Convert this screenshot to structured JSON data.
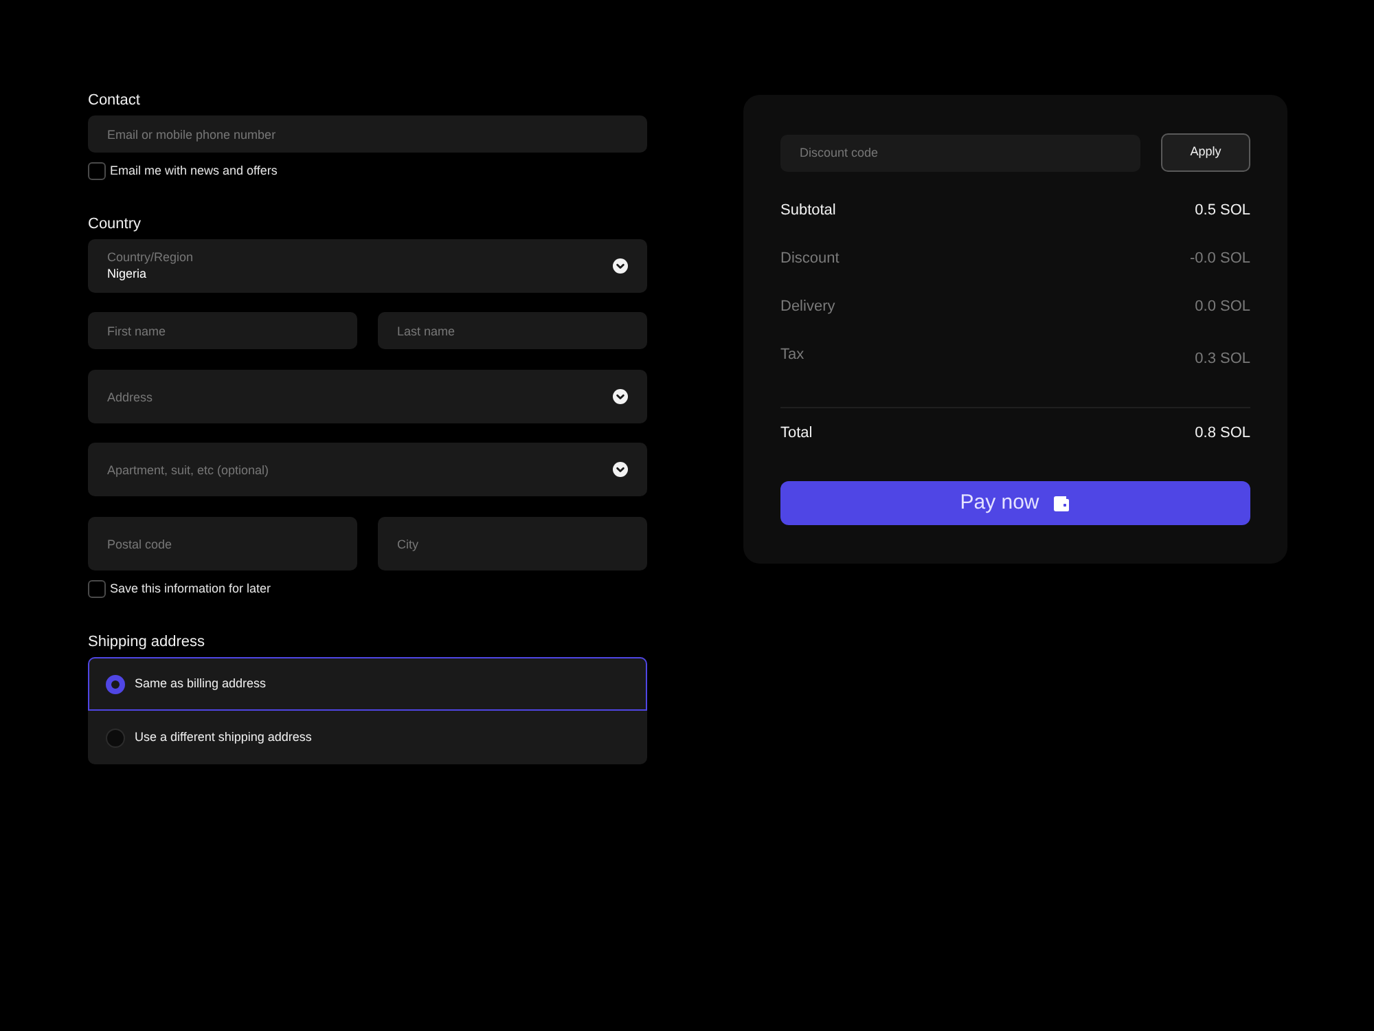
{
  "contact": {
    "heading": "Contact",
    "email": {
      "placeholder": "Email or mobile phone number"
    },
    "newsletter": {
      "label": "Email me with news and offers",
      "checked": false
    }
  },
  "country": {
    "heading": "Country",
    "select": {
      "label": "Country/Region",
      "value": "Nigeria"
    }
  },
  "name_fields": [
    {
      "placeholder": "First name"
    },
    {
      "placeholder": "Last name"
    }
  ],
  "address": {
    "placeholder": "Address"
  },
  "apartment": {
    "placeholder": "Apartment, suit, etc (optional)"
  },
  "location_fields": [
    {
      "placeholder": "Postal code"
    },
    {
      "placeholder": "City"
    }
  ],
  "save_info": {
    "label": "Save this information for later",
    "checked": false
  },
  "shipping": {
    "heading": "Shipping address",
    "options": [
      {
        "label": "Same as billing address",
        "selected": true
      },
      {
        "label": "Use a different shipping address",
        "selected": false
      }
    ]
  },
  "summary": {
    "discount": {
      "placeholder": "Discount code"
    },
    "apply": "Apply",
    "lines": [
      {
        "label": "Subtotal",
        "value": "0.5 SOL",
        "kind": "main"
      },
      {
        "label": "Discount",
        "value": "-0.0 SOL",
        "kind": "minor"
      },
      {
        "label": "Delivery",
        "value": "0.0 SOL",
        "kind": "minor"
      },
      {
        "label": "Tax",
        "value": "0.3 SOL",
        "kind": "minor"
      }
    ],
    "total": {
      "label": "Total",
      "value": "0.8 SOL"
    },
    "pay": "Pay now"
  }
}
